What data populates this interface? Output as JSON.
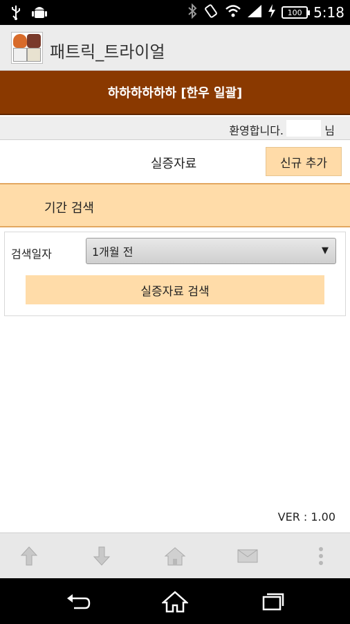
{
  "status_bar": {
    "battery": "100",
    "time": "5:18",
    "icons": [
      "usb-icon",
      "android-icon",
      "bluetooth-icon",
      "vibrate-icon",
      "wifi-icon",
      "signal-icon",
      "charging-icon"
    ]
  },
  "app": {
    "title": "패트릭_트라이얼",
    "logo_icon": "app-logo-icon"
  },
  "banner": {
    "text": "하하하하하하 [한우 일괄]"
  },
  "welcome": {
    "text": "환영합니다.",
    "suffix": "님"
  },
  "section": {
    "title": "실증자료",
    "new_button": "신규 추가"
  },
  "period": {
    "label": "기간 검색"
  },
  "search": {
    "date_label": "검색일자",
    "date_selected": "1개월 전",
    "search_button": "실증자료 검색"
  },
  "footer": {
    "version": "VER : 1.00"
  },
  "toolbar": {
    "items": [
      "upload-icon",
      "download-icon",
      "home-icon",
      "mail-icon",
      "more-icon"
    ]
  },
  "navbar": {
    "items": [
      "back-icon",
      "home-icon",
      "recent-apps-icon"
    ]
  },
  "colors": {
    "banner": "#8a3900",
    "accent_light": "#ffdca9",
    "accent_border": "#e3a760"
  }
}
